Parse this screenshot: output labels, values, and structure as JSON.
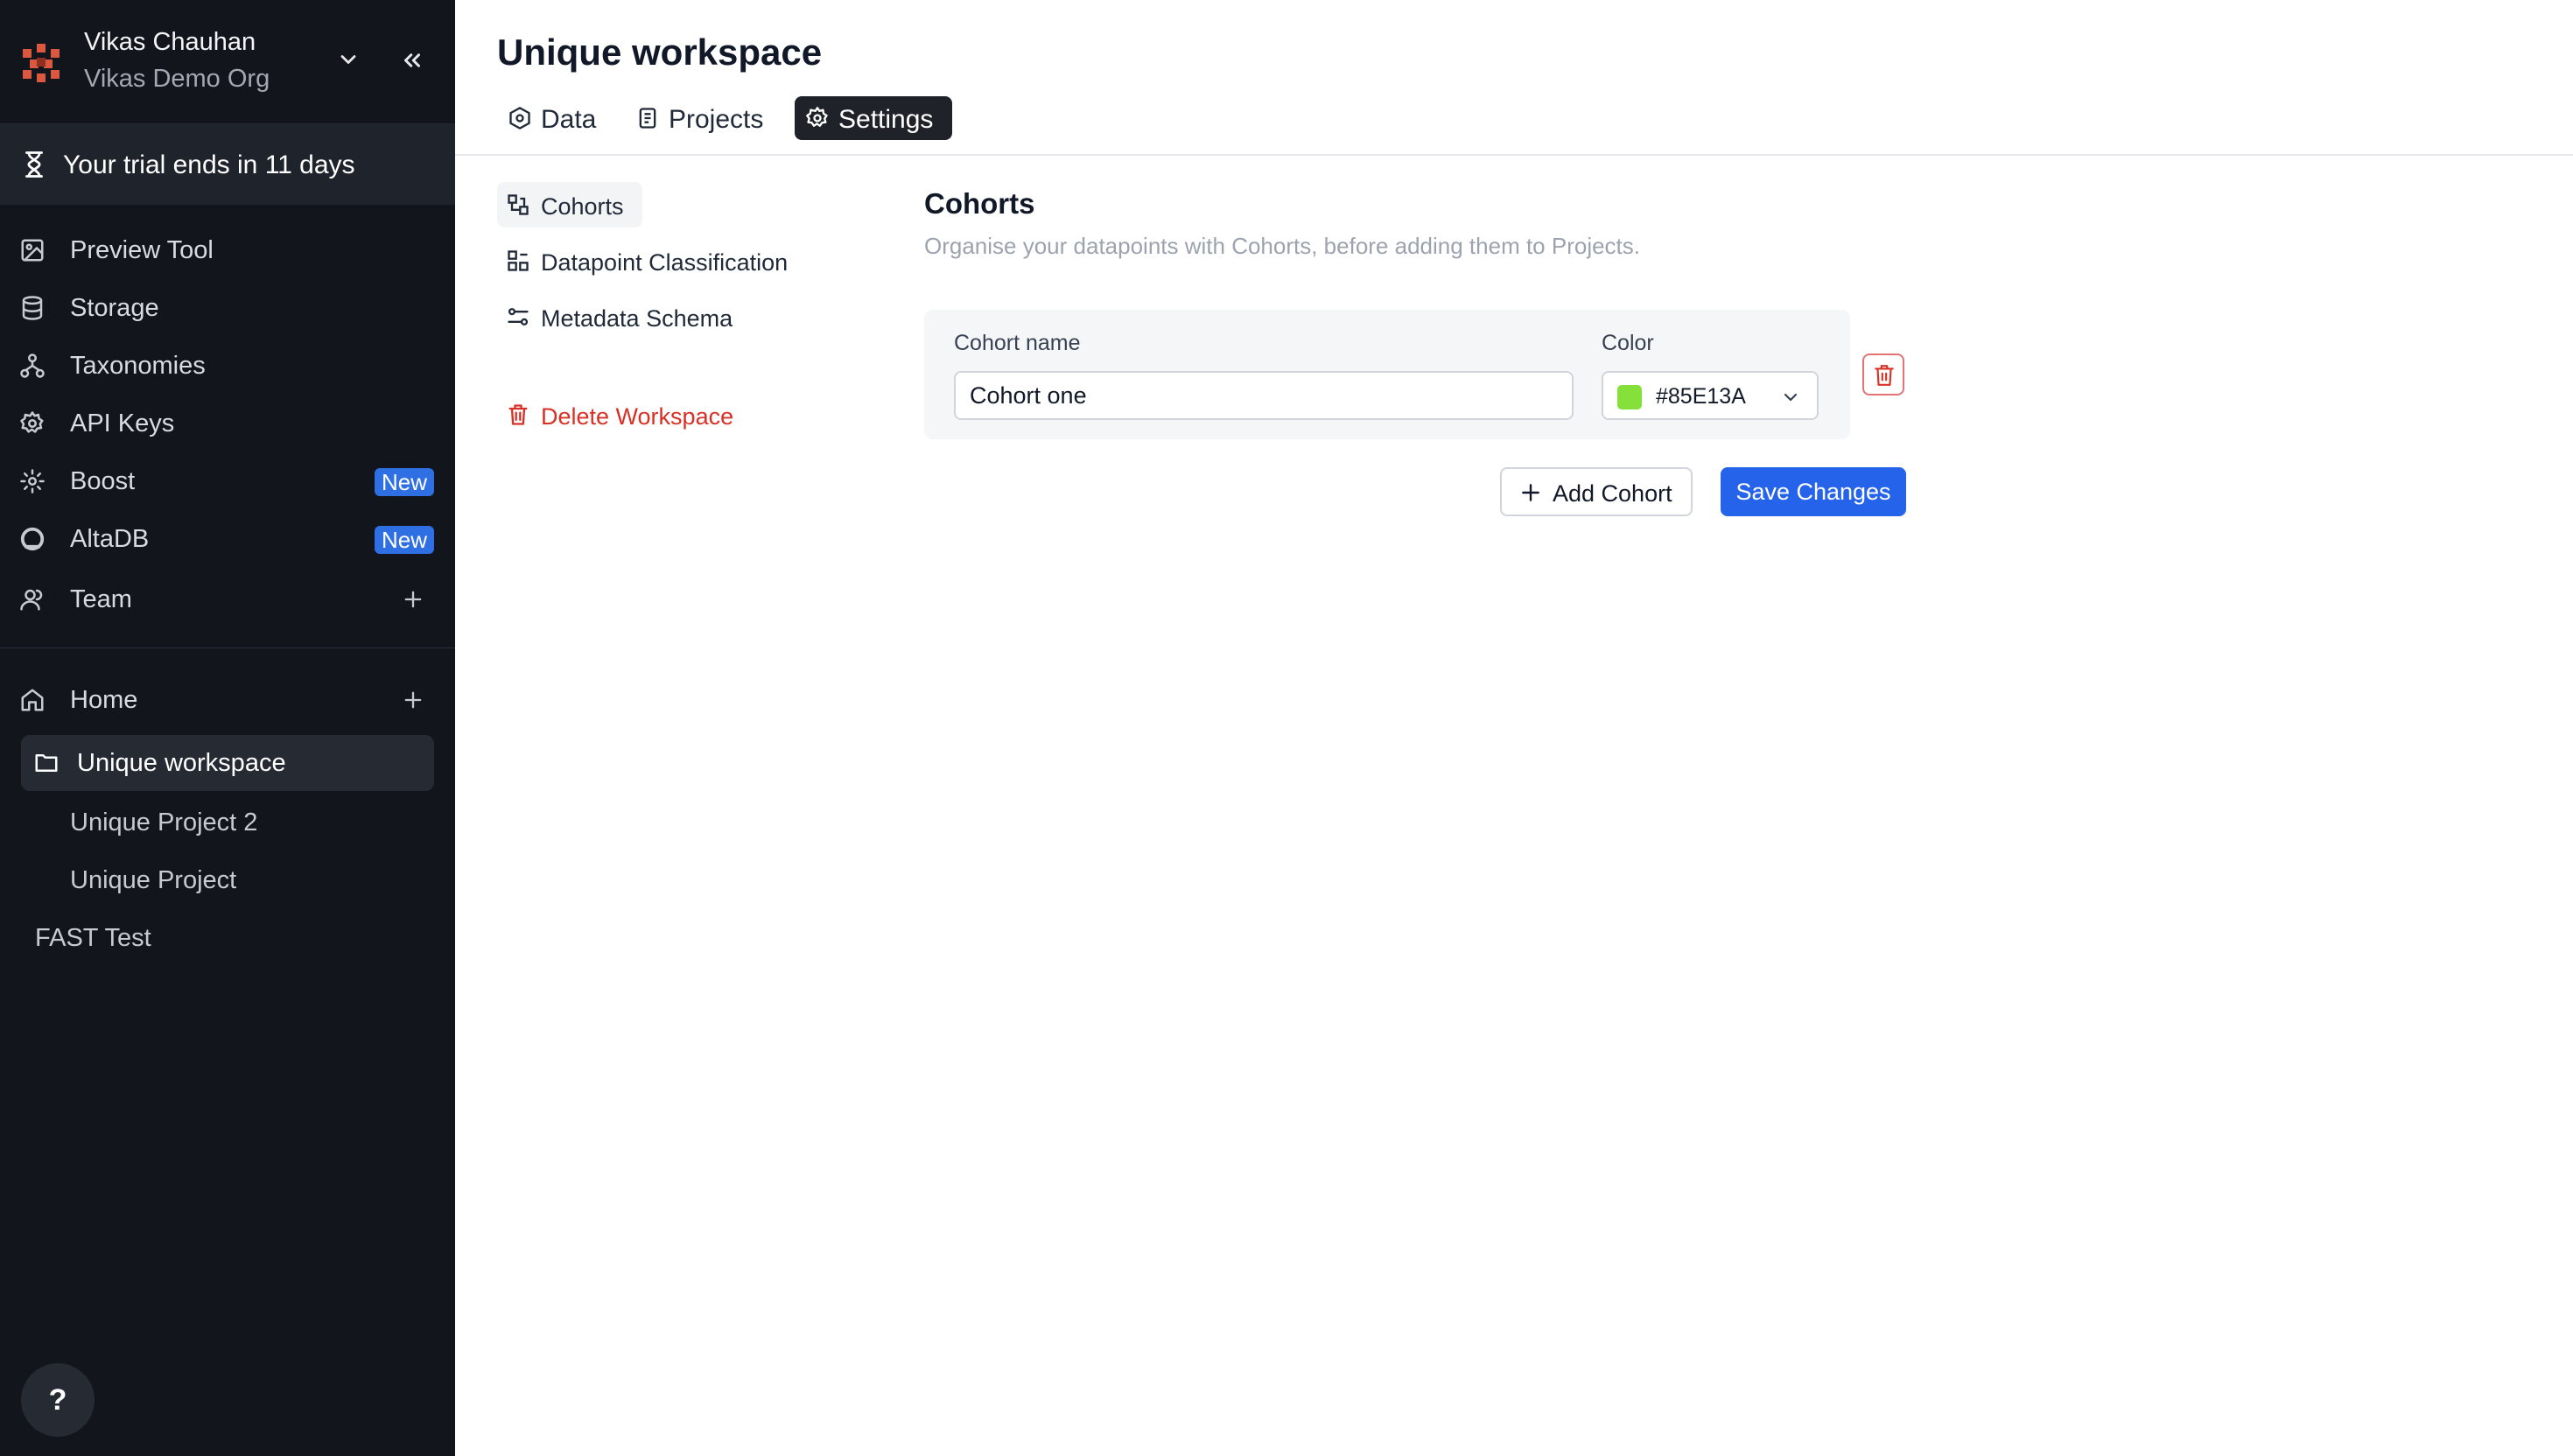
{
  "sidebar": {
    "user_name": "Vikas Chauhan",
    "org_name": "Vikas Demo Org",
    "trial_text": "Your trial ends in 11 days",
    "nav": [
      {
        "label": "Preview Tool",
        "icon": "preview-icon"
      },
      {
        "label": "Storage",
        "icon": "database-icon"
      },
      {
        "label": "Taxonomies",
        "icon": "hierarchy-icon"
      },
      {
        "label": "API Keys",
        "icon": "gear-icon"
      },
      {
        "label": "Boost",
        "icon": "sparkle-icon",
        "badge": "New"
      },
      {
        "label": "AltaDB",
        "icon": "altadb-icon",
        "badge": "New"
      },
      {
        "label": "Team",
        "icon": "user-icon"
      }
    ],
    "home_label": "Home",
    "workspace_label": "Unique workspace",
    "projects": [
      "Unique Project 2",
      "Unique Project"
    ],
    "extra_item": "FAST Test",
    "help_label": "?"
  },
  "main": {
    "title": "Unique workspace",
    "tabs": [
      {
        "label": "Data",
        "icon": "data-icon"
      },
      {
        "label": "Projects",
        "icon": "document-icon"
      },
      {
        "label": "Settings",
        "icon": "gear-icon",
        "active": true
      }
    ],
    "settings_nav": [
      {
        "label": "Cohorts",
        "icon": "cohorts-icon",
        "active": true
      },
      {
        "label": "Datapoint Classification",
        "icon": "classification-icon"
      },
      {
        "label": "Metadata Schema",
        "icon": "schema-icon"
      }
    ],
    "delete_workspace_label": "Delete Workspace",
    "section": {
      "title": "Cohorts",
      "description": "Organise your datapoints with Cohorts, before adding them to Projects.",
      "name_label": "Cohort name",
      "color_label": "Color",
      "cohort_name": "Cohort one",
      "cohort_color": "#85E13A",
      "add_label": "Add Cohort",
      "save_label": "Save Changes"
    }
  },
  "colors": {
    "sidebar_bg": "#12151c",
    "accent": "#2563eb",
    "badge": "#2f6fe4",
    "danger": "#d93025"
  }
}
